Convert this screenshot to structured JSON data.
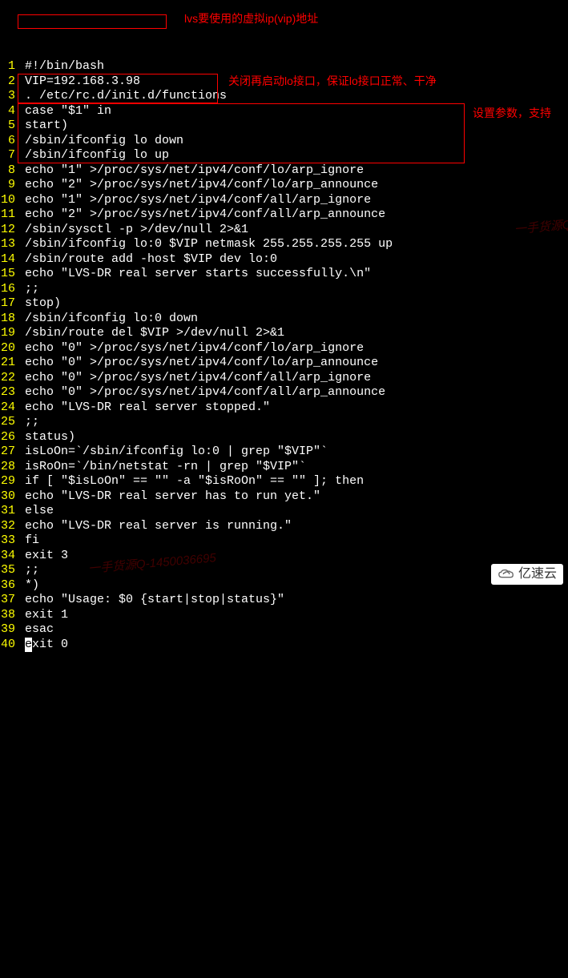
{
  "lines": [
    {
      "n": "1",
      "c": "#!/bin/bash"
    },
    {
      "n": "2",
      "c": "VIP=192.168.3.98"
    },
    {
      "n": "3",
      "c": ". /etc/rc.d/init.d/functions"
    },
    {
      "n": "4",
      "c": "case \"$1\" in"
    },
    {
      "n": "5",
      "c": "start)"
    },
    {
      "n": "6",
      "c": "/sbin/ifconfig lo down"
    },
    {
      "n": "7",
      "c": "/sbin/ifconfig lo up"
    },
    {
      "n": "8",
      "c": "echo \"1\" >/proc/sys/net/ipv4/conf/lo/arp_ignore"
    },
    {
      "n": "9",
      "c": "echo \"2\" >/proc/sys/net/ipv4/conf/lo/arp_announce"
    },
    {
      "n": "10",
      "c": "echo \"1\" >/proc/sys/net/ipv4/conf/all/arp_ignore"
    },
    {
      "n": "11",
      "c": "echo \"2\" >/proc/sys/net/ipv4/conf/all/arp_announce"
    },
    {
      "n": "12",
      "c": "/sbin/sysctl -p >/dev/null 2>&1"
    },
    {
      "n": "13",
      "c": "/sbin/ifconfig lo:0 $VIP netmask 255.255.255.255 up"
    },
    {
      "n": "14",
      "c": "/sbin/route add -host $VIP dev lo:0"
    },
    {
      "n": "15",
      "c": "echo \"LVS-DR real server starts successfully.\\n\""
    },
    {
      "n": "16",
      "c": ";;"
    },
    {
      "n": "17",
      "c": "stop)"
    },
    {
      "n": "18",
      "c": "/sbin/ifconfig lo:0 down"
    },
    {
      "n": "19",
      "c": "/sbin/route del $VIP >/dev/null 2>&1"
    },
    {
      "n": "20",
      "c": "echo \"0\" >/proc/sys/net/ipv4/conf/lo/arp_ignore"
    },
    {
      "n": "21",
      "c": "echo \"0\" >/proc/sys/net/ipv4/conf/lo/arp_announce"
    },
    {
      "n": "22",
      "c": "echo \"0\" >/proc/sys/net/ipv4/conf/all/arp_ignore"
    },
    {
      "n": "23",
      "c": "echo \"0\" >/proc/sys/net/ipv4/conf/all/arp_announce"
    },
    {
      "n": "24",
      "c": "echo \"LVS-DR real server stopped.\""
    },
    {
      "n": "25",
      "c": ";;"
    },
    {
      "n": "26",
      "c": "status)"
    },
    {
      "n": "27",
      "c": "isLoOn=`/sbin/ifconfig lo:0 | grep \"$VIP\"`"
    },
    {
      "n": "28",
      "c": "isRoOn=`/bin/netstat -rn | grep \"$VIP\"`"
    },
    {
      "n": "29",
      "c": "if [ \"$isLoOn\" == \"\" -a \"$isRoOn\" == \"\" ]; then"
    },
    {
      "n": "30",
      "c": "echo \"LVS-DR real server has to run yet.\""
    },
    {
      "n": "31",
      "c": "else"
    },
    {
      "n": "32",
      "c": "echo \"LVS-DR real server is running.\""
    },
    {
      "n": "33",
      "c": "fi"
    },
    {
      "n": "34",
      "c": "exit 3"
    },
    {
      "n": "35",
      "c": ";;"
    },
    {
      "n": "36",
      "c": "*)"
    },
    {
      "n": "37",
      "c": "echo \"Usage: $0 {start|stop|status}\""
    },
    {
      "n": "38",
      "c": "exit 1"
    },
    {
      "n": "39",
      "c": "esac"
    }
  ],
  "lastline": {
    "n": "40",
    "prefix": "e",
    "rest": "xit 0"
  },
  "annotations": {
    "a1": "lvs要使用的虚拟ip(vip)地址",
    "a2": "关闭再启动lo接口，保证lo接口正常、干净",
    "a3": "设置参数，支持"
  },
  "watermarks": {
    "w1": "一手货源Q-",
    "w2": "一手货源Q-1450036695"
  },
  "logo": "亿速云"
}
